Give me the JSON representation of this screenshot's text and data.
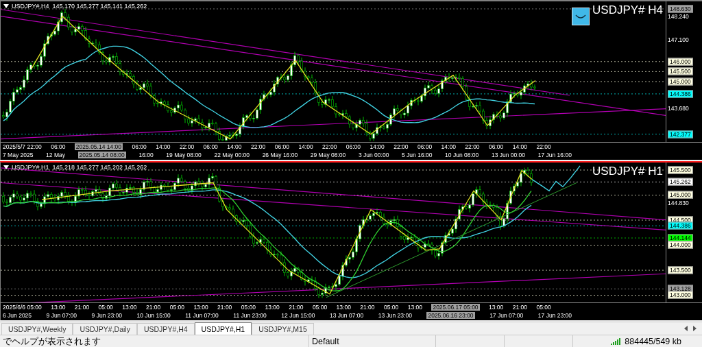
{
  "panels": [
    {
      "active": false,
      "has_logo": true,
      "header": "USDJPY#,H4  145.170 145.277 145.141 145.262",
      "symbol": "USDJPY# H4",
      "price_labels": [
        {
          "text": "148.630",
          "kind": "tag",
          "color": "#a0a0a0"
        },
        {
          "text": "148.240",
          "kind": "tick"
        },
        {
          "text": "147.100",
          "kind": "tick"
        },
        {
          "text": "146.000",
          "kind": "tag",
          "color": "#ffffe0"
        },
        {
          "text": "145.500",
          "kind": "tag",
          "color": "#ffffe0"
        },
        {
          "text": "145.000",
          "kind": "tag",
          "color": "#ffffe0"
        },
        {
          "text": "144.386",
          "kind": "tag",
          "color": "#00ffff"
        },
        {
          "text": "143.680",
          "kind": "tick"
        },
        {
          "text": "142.377",
          "kind": "tag",
          "color": "#00ffff"
        }
      ],
      "time_rows": [
        [
          {
            "text": "2025/5/7 22:00",
            "highlighted": false
          },
          {
            "text": "06:00",
            "highlighted": false
          },
          {
            "text": "2025.05.14 14:00",
            "highlighted": true
          },
          {
            "text": "06:00",
            "highlighted": false
          },
          {
            "text": "14:00",
            "highlighted": false
          },
          {
            "text": "22:00",
            "highlighted": false
          },
          {
            "text": "06:00",
            "highlighted": false
          },
          {
            "text": "14:00",
            "highlighted": false
          },
          {
            "text": "22:00",
            "highlighted": false
          },
          {
            "text": "06:00",
            "highlighted": false
          },
          {
            "text": "14:00",
            "highlighted": false
          },
          {
            "text": "22:00",
            "highlighted": false
          },
          {
            "text": "06:00",
            "highlighted": false
          },
          {
            "text": "14:00",
            "highlighted": false
          },
          {
            "text": "22:00",
            "highlighted": false
          },
          {
            "text": "06:00",
            "highlighted": false
          },
          {
            "text": "14:00",
            "highlighted": false
          },
          {
            "text": "22:00",
            "highlighted": false
          },
          {
            "text": "06:00",
            "highlighted": false
          },
          {
            "text": "14:00",
            "highlighted": false
          },
          {
            "text": "22:00",
            "highlighted": false
          }
        ],
        [
          {
            "text": "7 May 2025",
            "highlighted": false
          },
          {
            "text": "12 May",
            "highlighted": false
          },
          {
            "text": "2025.05.14 08:00",
            "highlighted": true
          },
          {
            "text": "16:00",
            "highlighted": false
          },
          {
            "text": "19 May 08:00",
            "highlighted": false
          },
          {
            "text": "22 May 00:00",
            "highlighted": false
          },
          {
            "text": "26 May 16:00",
            "highlighted": false
          },
          {
            "text": "29 May 08:00",
            "highlighted": false
          },
          {
            "text": "3 Jun 00:00",
            "highlighted": false
          },
          {
            "text": "5 Jun 16:00",
            "highlighted": false
          },
          {
            "text": "10 Jun 08:00",
            "highlighted": false
          },
          {
            "text": "13 Jun 00:00",
            "highlighted": false
          },
          {
            "text": "17 Jun 16:00",
            "highlighted": false
          }
        ]
      ]
    },
    {
      "active": true,
      "has_logo": false,
      "header": "USDJPY#,H1  145.218 145.277 145.202 145.262",
      "symbol": "USDJPY# H1",
      "price_labels": [
        {
          "text": "145.500",
          "kind": "tag",
          "color": "#ffffe0"
        },
        {
          "text": "145.262",
          "kind": "tag",
          "color": "#ffffff"
        },
        {
          "text": "145.000",
          "kind": "tag",
          "color": "#ffffe0"
        },
        {
          "text": "144.830",
          "kind": "tick"
        },
        {
          "text": "144.500",
          "kind": "tag",
          "color": "#ffffe0"
        },
        {
          "text": "144.386",
          "kind": "tag",
          "color": "#00ffff"
        },
        {
          "text": "144.144",
          "kind": "tag",
          "color": "#00ff00"
        },
        {
          "text": "144.000",
          "kind": "tag",
          "color": "#ffffe0"
        },
        {
          "text": "143.500",
          "kind": "tag",
          "color": "#ffffe0"
        },
        {
          "text": "143.128",
          "kind": "tag",
          "color": "#a0a0a0"
        },
        {
          "text": "143.000",
          "kind": "tag",
          "color": "#ffffe0"
        }
      ],
      "time_rows": [
        [
          {
            "text": "2025/6/6 05:00",
            "highlighted": false
          },
          {
            "text": "13:00",
            "highlighted": false
          },
          {
            "text": "21:00",
            "highlighted": false
          },
          {
            "text": "05:00",
            "highlighted": false
          },
          {
            "text": "13:00",
            "highlighted": false
          },
          {
            "text": "21:00",
            "highlighted": false
          },
          {
            "text": "05:00",
            "highlighted": false
          },
          {
            "text": "13:00",
            "highlighted": false
          },
          {
            "text": "21:00",
            "highlighted": false
          },
          {
            "text": "05:00",
            "highlighted": false
          },
          {
            "text": "13:00",
            "highlighted": false
          },
          {
            "text": "21:00",
            "highlighted": false
          },
          {
            "text": "05:00",
            "highlighted": false
          },
          {
            "text": "13:00",
            "highlighted": false
          },
          {
            "text": "21:00",
            "highlighted": false
          },
          {
            "text": "05:00",
            "highlighted": false
          },
          {
            "text": "13:00",
            "highlighted": false
          },
          {
            "text": "2025.06.17 05:00",
            "highlighted": true
          },
          {
            "text": "13:00",
            "highlighted": false
          },
          {
            "text": "21:00",
            "highlighted": false
          },
          {
            "text": "05:00",
            "highlighted": false
          }
        ],
        [
          {
            "text": "6 Jun 2025",
            "highlighted": false
          },
          {
            "text": "9 Jun 07:00",
            "highlighted": false
          },
          {
            "text": "9 Jun 23:00",
            "highlighted": false
          },
          {
            "text": "10 Jun 15:00",
            "highlighted": false
          },
          {
            "text": "11 Jun 07:00",
            "highlighted": false
          },
          {
            "text": "11 Jun 23:00",
            "highlighted": false
          },
          {
            "text": "12 Jun 15:00",
            "highlighted": false
          },
          {
            "text": "13 Jun 07:00",
            "highlighted": false
          },
          {
            "text": "13 Jun 23:00",
            "highlighted": false
          },
          {
            "text": "2025.06.16 23:00",
            "highlighted": true
          },
          {
            "text": "17 Jun 07:00",
            "highlighted": false
          },
          {
            "text": "17 Jun 23:00",
            "highlighted": false
          }
        ]
      ]
    }
  ],
  "tabs": [
    {
      "label": "USDJPY#,Weekly",
      "selected": false
    },
    {
      "label": "USDJPY#,Daily",
      "selected": false
    },
    {
      "label": "USDJPY#,H4",
      "selected": false
    },
    {
      "label": "USDJPY#,H1",
      "selected": true
    },
    {
      "label": "USDJPY#,M15",
      "selected": false
    }
  ],
  "status_bar": {
    "help": "でヘルプが表示されます",
    "profile": "Default",
    "traffic": "884445/549 kb"
  }
}
